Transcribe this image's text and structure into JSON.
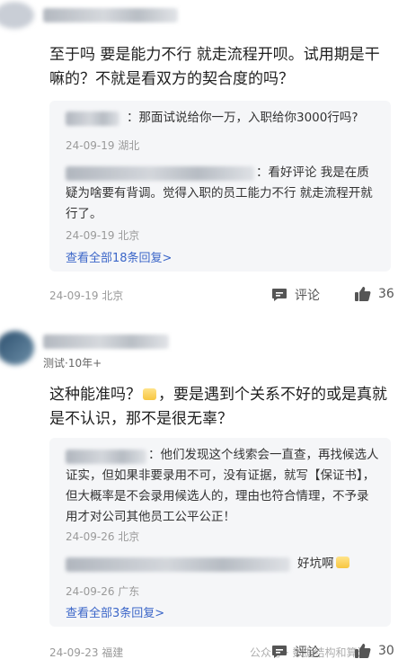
{
  "comments": [
    {
      "text": "至于吗 要是能力不行 就走流程开呗。试用期是干嘛的？不就是看双方的契合度的吗？",
      "replies": [
        {
          "text": "：那面试说给你一万，入职给你3000行吗?",
          "meta": "24-09-19 湖北"
        },
        {
          "text": "：看好评论 我是在质疑为啥要有背调。觉得入职的员工能力不行 就走流程开就行了。",
          "meta": "24-09-19 北京"
        }
      ],
      "see_all": "查看全部18条回复>",
      "meta": "24-09-19 北京",
      "comment_label": "评论",
      "likes": "36"
    },
    {
      "tag": "测试·10年+",
      "text_part1": "这种能准吗？",
      "text_part2": "，要是遇到个关系不好的或是真就是不认识，那不是很无辜？",
      "replies": [
        {
          "text": "：他们发现这个线索会一直查，再找候选人证实，但如果非要录用不可，没有证据，就写【保证书】，但大概率是不会录用候选人的，理由也符合情理，不予录用才对公司其他员工公平公正！",
          "meta": "24-09-26 北京"
        },
        {
          "text": "好坑啊",
          "meta": "24-09-26 广东"
        }
      ],
      "see_all": "查看全部3条回复>",
      "meta": "24-09-23 福建",
      "comment_label": "评论",
      "likes": "30",
      "watermark": "公众号 · 数据结构和算法"
    }
  ],
  "icons": {
    "comment": "comment-icon",
    "like": "thumbs-up-icon",
    "emoji": "emoji-icon"
  }
}
